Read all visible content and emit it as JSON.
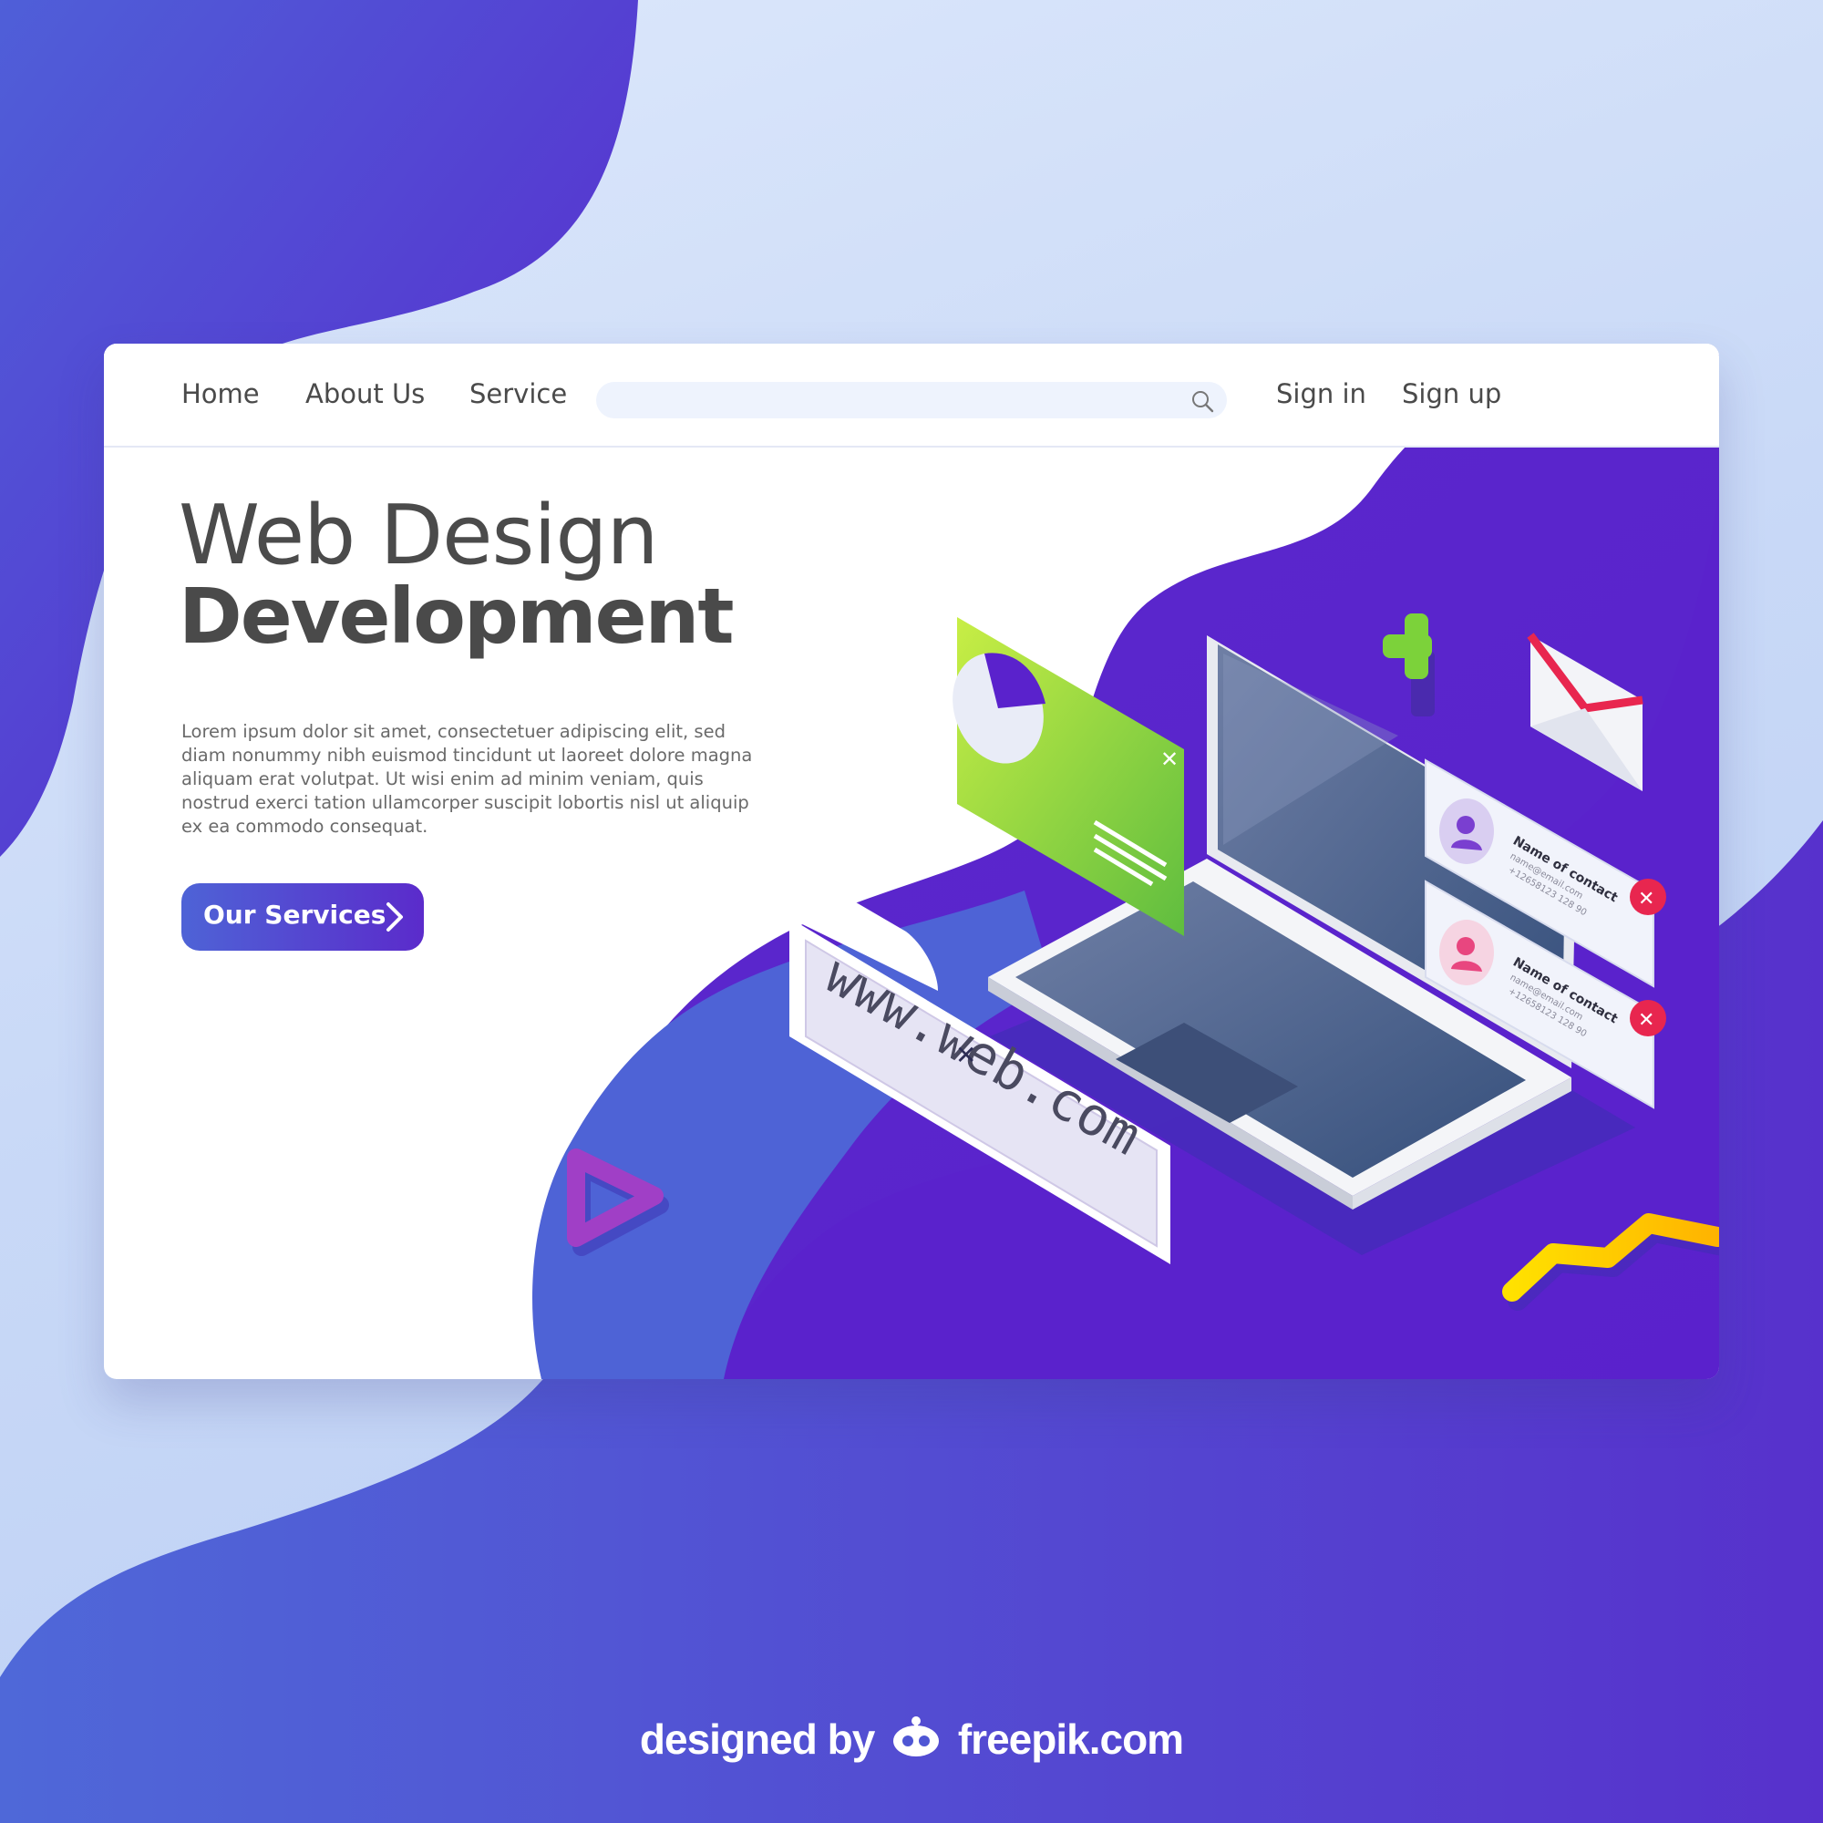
{
  "nav": {
    "home": "Home",
    "about": "About Us",
    "service": "Service",
    "search_placeholder": "",
    "signin": "Sign in",
    "signup": "Sign up"
  },
  "hero": {
    "line1": "Web Design",
    "line2": "Development",
    "body": "Lorem ipsum dolor sit amet, consectetuer adipiscing elit, sed diam nonummy nibh euismod tincidunt ut laoreet dolore magna aliquam erat volutpat. Ut wisi enim ad minim veniam, quis nostrud exerci tation ullamcorper suscipit lobortis nisl ut aliquip ex ea commodo consequat.",
    "cta": "Our Services"
  },
  "illustration": {
    "url_text": "www.web.com",
    "contacts": [
      {
        "name": "Name of contact",
        "email": "name@email.com",
        "phone": "+12658123 128 90"
      },
      {
        "name": "Name of contact",
        "email": "name@email.com",
        "phone": "+12658123 128 90"
      }
    ]
  },
  "credit": {
    "prefix": "designed by",
    "brand": "freepik.com"
  },
  "colors": {
    "purple_deep": "#5a23cc",
    "purple_blue": "#4e63d6",
    "green": "#7cd23a",
    "yellow": "#ffcc00",
    "red": "#e8264f"
  }
}
